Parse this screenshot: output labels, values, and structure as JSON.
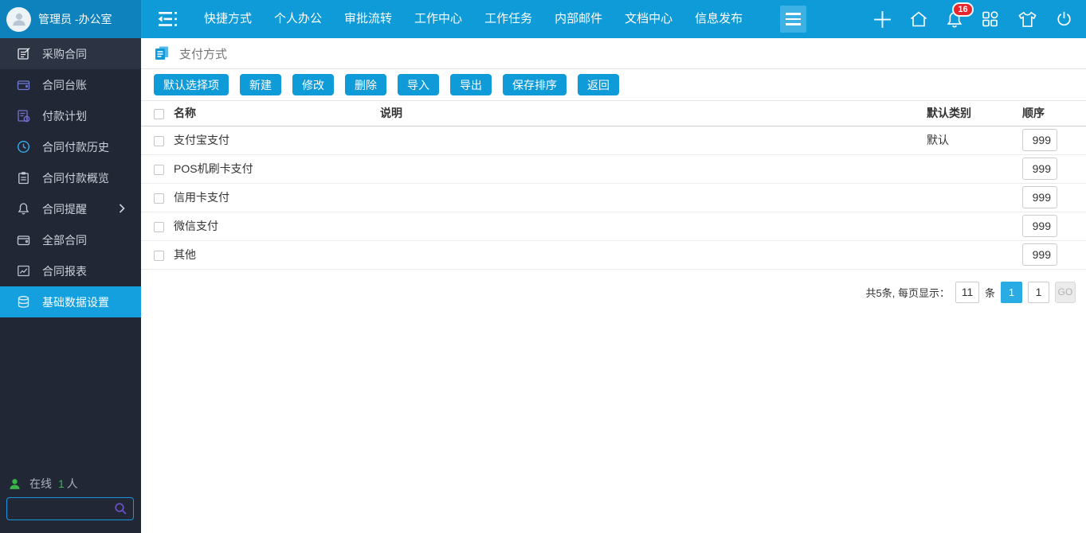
{
  "topbar": {
    "user_name": "管理员 -办公室",
    "nav_items": [
      "快捷方式",
      "个人办公",
      "审批流转",
      "工作中心",
      "工作任务",
      "内部邮件",
      "文档中心",
      "信息发布"
    ],
    "notification_badge": "16"
  },
  "sidebar": {
    "items": [
      {
        "label": "采购合同",
        "icon": "document-edit-icon"
      },
      {
        "label": "合同台账",
        "icon": "wallet-icon"
      },
      {
        "label": "付款计划",
        "icon": "payment-plan-icon"
      },
      {
        "label": "合同付款历史",
        "icon": "clock-icon"
      },
      {
        "label": "合同付款概览",
        "icon": "clipboard-icon"
      },
      {
        "label": "合同提醒",
        "icon": "bell-icon",
        "expandable": true
      },
      {
        "label": "全部合同",
        "icon": "wallet-icon"
      },
      {
        "label": "合同报表",
        "icon": "chart-icon"
      },
      {
        "label": "基础数据设置",
        "icon": "database-icon",
        "active": true
      }
    ],
    "online_prefix": "在线",
    "online_count": "1",
    "online_suffix": "人"
  },
  "page": {
    "title": "支付方式"
  },
  "toolbar": {
    "buttons": [
      "默认选择项",
      "新建",
      "修改",
      "删除",
      "导入",
      "导出",
      "保存排序",
      "返回"
    ]
  },
  "table": {
    "headers": {
      "name": "名称",
      "description": "说明",
      "default_category": "默认类别",
      "order": "顺序"
    },
    "rows": [
      {
        "name": "支付宝支付",
        "description": "",
        "default_category": "默认",
        "order": "999"
      },
      {
        "name": "POS机刷卡支付",
        "description": "",
        "default_category": "",
        "order": "999"
      },
      {
        "name": "信用卡支付",
        "description": "",
        "default_category": "",
        "order": "999"
      },
      {
        "name": "微信支付",
        "description": "",
        "default_category": "",
        "order": "999"
      },
      {
        "name": "其他",
        "description": "",
        "default_category": "",
        "order": "999"
      }
    ]
  },
  "pagination": {
    "summary": "共5条, 每页显示：",
    "page_size": "11",
    "unit": "条",
    "current_page": "1",
    "goto_value": "1",
    "go_label": "GO"
  },
  "colors": {
    "topbar_blue": "#0f9ad8",
    "topbar_user_block": "#0e82bd",
    "sidebar_bg": "#212734",
    "active_item_blue": "#14a0de",
    "button_blue": "#0f9ad8",
    "badge_red": "#e8262d",
    "online_green": "#3bb54a",
    "search_border_blue": "#1c95e0",
    "search_icon_purple": "#6b4fc1"
  }
}
